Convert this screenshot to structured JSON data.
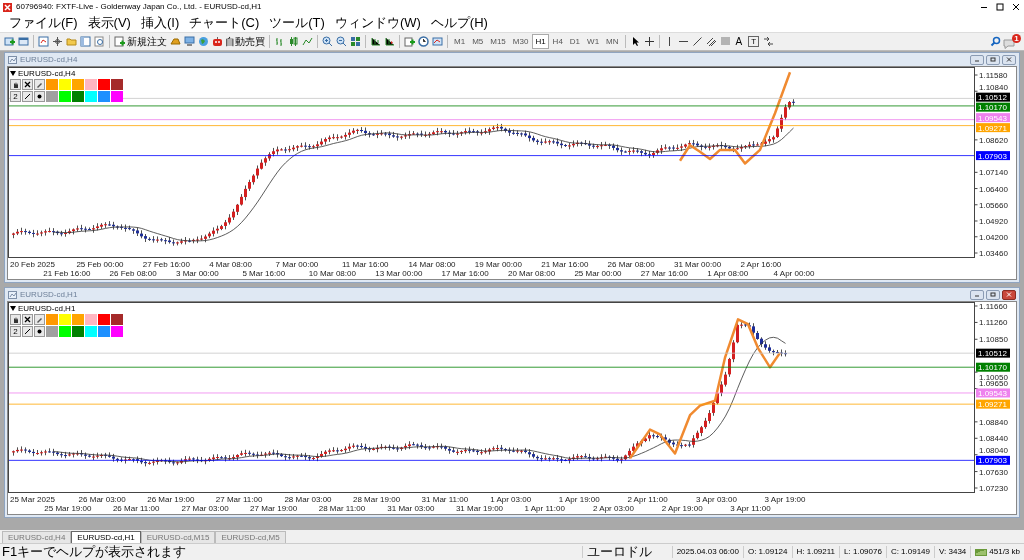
{
  "window": {
    "title": "60796940: FXTF-Live - Goldenway Japan Co., Ltd. - EURUSD-cd,H1"
  },
  "menu": [
    "ファイル(F)",
    "表示(V)",
    "挿入(I)",
    "チャート(C)",
    "ツール(T)",
    "ウィンドウ(W)",
    "ヘルプ(H)"
  ],
  "toolbar": {
    "order_button": "新規注文",
    "autotrade_button": "自動売買",
    "timeframes": [
      {
        "label": "M1",
        "selected": false
      },
      {
        "label": "M5",
        "selected": false
      },
      {
        "label": "M15",
        "selected": false
      },
      {
        "label": "M30",
        "selected": false
      },
      {
        "label": "H1",
        "selected": true
      },
      {
        "label": "H4",
        "selected": false
      },
      {
        "label": "D1",
        "selected": false
      },
      {
        "label": "W1",
        "selected": false
      },
      {
        "label": "MN",
        "selected": false
      }
    ],
    "text_tool": "A",
    "label_tool": "T",
    "notification_count": "1"
  },
  "charts": [
    {
      "title": "EURUSD-cd,H4",
      "label": "EURUSD-cd,H4",
      "active": false,
      "palette": {
        "width_label": "2",
        "colors": [
          {
            "color": "#ff9900"
          },
          {
            "color": "#ffff00"
          },
          {
            "color": "#ffa500"
          },
          {
            "color": "#ffb6c1"
          },
          {
            "color": "#ff0000"
          },
          {
            "color": "#a52a2a"
          },
          {
            "color": "#a0a0a0"
          },
          {
            "color": "#00ff00"
          },
          {
            "color": "#008000"
          },
          {
            "color": "#00ffff"
          },
          {
            "color": "#1e90ff"
          },
          {
            "color": "#ff00ff"
          }
        ]
      },
      "price_ticks": [
        "1.11580",
        "1.10840",
        "1.08620",
        "1.07140",
        "1.06400",
        "1.05660",
        "1.04920",
        "1.04200",
        "1.03460"
      ],
      "price_lines": [
        {
          "kind": "bid",
          "label": "1.10512",
          "color": "#000000"
        },
        {
          "kind": "level",
          "label": "1.10170",
          "color": "#008000"
        },
        {
          "kind": "level",
          "label": "1.09543",
          "color": "#ee82ee"
        },
        {
          "kind": "level",
          "label": "1.09271",
          "color": "#ffa500"
        },
        {
          "kind": "level",
          "label": "1.07903",
          "color": "#0000ff"
        }
      ],
      "time_labels": [
        "20 Feb 2025",
        "21 Feb 16:00",
        "25 Feb 00:00",
        "26 Feb 08:00",
        "27 Feb 16:00",
        "3 Mar 00:00",
        "4 Mar 08:00",
        "5 Mar 16:00",
        "7 Mar 00:00",
        "10 Mar 08:00",
        "11 Mar 16:00",
        "13 Mar 00:00",
        "14 Mar 08:00",
        "17 Mar 16:00",
        "19 Mar 00:00",
        "20 Mar 08:00",
        "21 Mar 16:00",
        "25 Mar 00:00",
        "26 Mar 08:00",
        "27 Mar 16:00",
        "31 Mar 00:00",
        "1 Apr 08:00",
        "2 Apr 16:00",
        "4 Apr 00:00"
      ]
    },
    {
      "title": "EURUSD-cd,H1",
      "label": "EURUSD-cd,H1",
      "active": true,
      "palette": {
        "width_label": "2",
        "colors": [
          {
            "color": "#ff9900"
          },
          {
            "color": "#ffff00"
          },
          {
            "color": "#ffa500"
          },
          {
            "color": "#ffb6c1"
          },
          {
            "color": "#ff0000"
          },
          {
            "color": "#a52a2a"
          },
          {
            "color": "#a0a0a0"
          },
          {
            "color": "#00ff00"
          },
          {
            "color": "#008000"
          },
          {
            "color": "#00ffff"
          },
          {
            "color": "#1e90ff"
          },
          {
            "color": "#ff00ff"
          }
        ]
      },
      "price_ticks": [
        "1.11660",
        "1.11260",
        "1.10850",
        "1.10050",
        "1.09650",
        "1.08840",
        "1.08440",
        "1.08040",
        "1.07630",
        "1.07230"
      ],
      "price_lines": [
        {
          "kind": "bid",
          "label": "1.10512",
          "color": "#000000"
        },
        {
          "kind": "level",
          "label": "1.10170",
          "color": "#008000"
        },
        {
          "kind": "level",
          "label": "1.09543",
          "color": "#ee82ee"
        },
        {
          "kind": "level",
          "label": "1.09271",
          "color": "#ffa500"
        },
        {
          "kind": "level",
          "label": "1.07903",
          "color": "#0000ff"
        }
      ],
      "time_labels": [
        "25 Mar 2025",
        "25 Mar 19:00",
        "26 Mar 03:00",
        "26 Mar 11:00",
        "26 Mar 19:00",
        "27 Mar 03:00",
        "27 Mar 11:00",
        "27 Mar 19:00",
        "28 Mar 03:00",
        "28 Mar 11:00",
        "28 Mar 19:00",
        "31 Mar 03:00",
        "31 Mar 11:00",
        "31 Mar 19:00",
        "1 Apr 03:00",
        "1 Apr 11:00",
        "1 Apr 19:00",
        "2 Apr 03:00",
        "2 Apr 11:00",
        "2 Apr 19:00",
        "3 Apr 03:00",
        "3 Apr 11:00",
        "3 Apr 19:00"
      ]
    }
  ],
  "tabs": [
    {
      "label": "EURUSD-cd,H4",
      "selected": false
    },
    {
      "label": "EURUSD-cd,H1",
      "selected": true
    },
    {
      "label": "EURUSD-cd,M15",
      "selected": false
    },
    {
      "label": "EURUSD-cd,M5",
      "selected": false
    }
  ],
  "status_bar": {
    "help": "F1キーでヘルプが表示されます",
    "profile": "ユーロドル",
    "time": "2025.04.03 06:00",
    "open": "O: 1.09124",
    "high": "H: 1.09211",
    "low": "L: 1.09076",
    "close": "C: 1.09149",
    "volume": "V: 3434",
    "traffic": "451/3 kb"
  }
}
